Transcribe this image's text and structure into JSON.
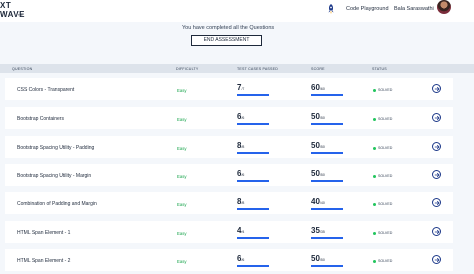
{
  "header": {
    "logo_line1": "XT",
    "logo_line2": "WAVE",
    "logo_tm": "TM",
    "playground_label": "Code Playground",
    "user_name": "Bala Saraswathi"
  },
  "banner": {
    "message": "You have completed all the Questions",
    "end_button": "END ASSESSMENT"
  },
  "table": {
    "columns": {
      "question": "QUESTION",
      "difficulty": "DIFFICULTY",
      "test_cases": "TEST CASES PASSED",
      "score": "SCORE",
      "status": "STATUS"
    },
    "rows": [
      {
        "question": "CSS Colors - Transparent",
        "difficulty": "Easy",
        "passed": "7",
        "total": "/7",
        "score": "60",
        "score_max": "/60",
        "status": "SOLVED"
      },
      {
        "question": "Bootstrap Containers",
        "difficulty": "Easy",
        "passed": "6",
        "total": "/6",
        "score": "50",
        "score_max": "/50",
        "status": "SOLVED"
      },
      {
        "question": "Bootstrap Spacing Utility - Padding",
        "difficulty": "Easy",
        "passed": "8",
        "total": "/8",
        "score": "50",
        "score_max": "/50",
        "status": "SOLVED"
      },
      {
        "question": "Bootstrap Spacing Utility - Margin",
        "difficulty": "Easy",
        "passed": "6",
        "total": "/6",
        "score": "50",
        "score_max": "/50",
        "status": "SOLVED"
      },
      {
        "question": "Combination of Padding and Margin",
        "difficulty": "Easy",
        "passed": "8",
        "total": "/8",
        "score": "40",
        "score_max": "/40",
        "status": "SOLVED"
      },
      {
        "question": "HTML Span Element - 1",
        "difficulty": "Easy",
        "passed": "4",
        "total": "/4",
        "score": "35",
        "score_max": "/35",
        "status": "SOLVED"
      },
      {
        "question": "HTML Span Element - 2",
        "difficulty": "Easy",
        "passed": "6",
        "total": "/6",
        "score": "50",
        "score_max": "/50",
        "status": "SOLVED"
      }
    ]
  },
  "colors": {
    "accent": "#2563eb",
    "easy": "#16a34a",
    "solved_dot": "#22c55e",
    "header_row": "#dde3eb"
  },
  "icons": {
    "playground": "rocket-icon",
    "row_action": "arrow-right-circle-icon"
  }
}
